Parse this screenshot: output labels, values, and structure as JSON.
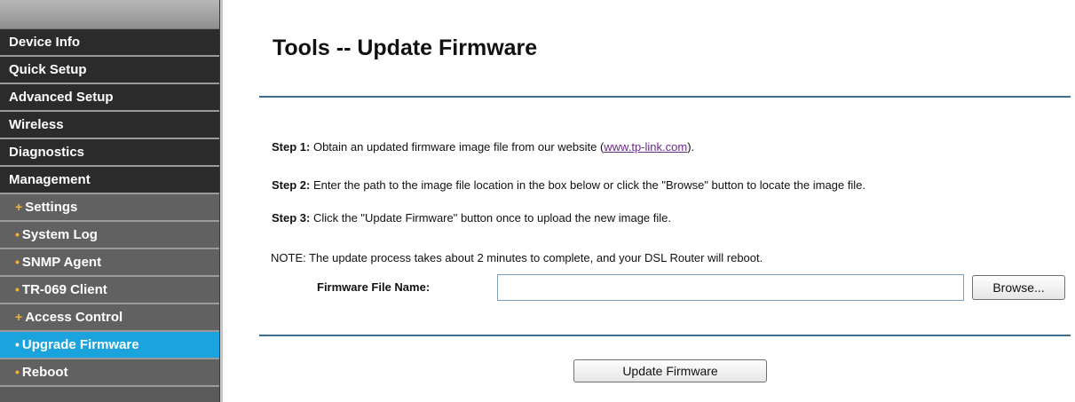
{
  "sidebar": {
    "items": [
      {
        "label": "Device Info",
        "level": "main"
      },
      {
        "label": "Quick Setup",
        "level": "main"
      },
      {
        "label": "Advanced Setup",
        "level": "main"
      },
      {
        "label": "Wireless",
        "level": "main"
      },
      {
        "label": "Diagnostics",
        "level": "main"
      },
      {
        "label": "Management",
        "level": "main"
      },
      {
        "label": "Settings",
        "level": "sub",
        "prefix": "+"
      },
      {
        "label": "System Log",
        "level": "sub",
        "prefix": "•"
      },
      {
        "label": "SNMP Agent",
        "level": "sub",
        "prefix": "•"
      },
      {
        "label": "TR-069 Client",
        "level": "sub",
        "prefix": "•"
      },
      {
        "label": "Access Control",
        "level": "sub",
        "prefix": "+"
      },
      {
        "label": "Upgrade Firmware",
        "level": "sub",
        "prefix": "•",
        "active": true
      },
      {
        "label": "Reboot",
        "level": "sub",
        "prefix": "•"
      }
    ],
    "active_color": "#1aa3dd",
    "bullet_color": "#f3b13a"
  },
  "page": {
    "title": "Tools -- Update Firmware",
    "step1_label": "Step 1:",
    "step1_text": " Obtain an updated firmware image file from our website (",
    "step1_link": "www.tp-link.com",
    "step1_end": ").",
    "step2_label": "Step 2:",
    "step2_text": " Enter the path to the image file location in the box below or click the \"Browse\" button to locate the image file.",
    "step3_label": "Step 3:",
    "step3_text": " Click the \"Update Firmware\" button once to upload the new image file.",
    "note": "NOTE: The update process takes about 2 minutes to complete, and your DSL Router will reboot.",
    "file_label": "Firmware File Name:",
    "file_value": "",
    "browse_label": "Browse...",
    "update_label": "Update Firmware"
  }
}
